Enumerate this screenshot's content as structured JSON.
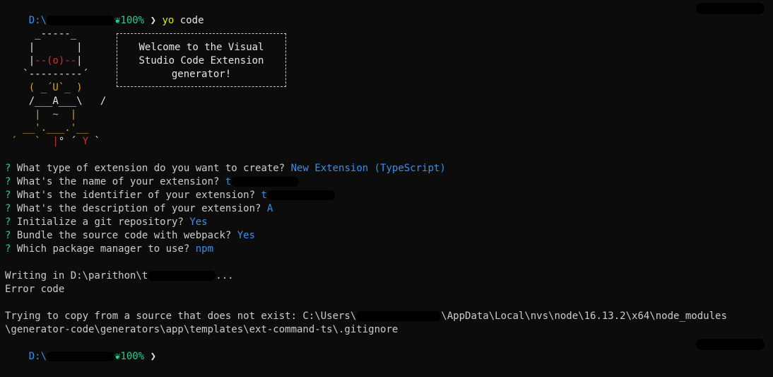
{
  "prompt": {
    "drive": "D:\\",
    "battery": "100%",
    "arrow": "❯",
    "command": "yo",
    "command_arg": "code"
  },
  "ascii_art": {
    "row1": "     _-----_",
    "row2": "    |       |",
    "row3a": "    |",
    "row3b": "--(o)--",
    "row3c": "|",
    "row4": "   `---------´",
    "row5": "    ( _´U`_ )",
    "row6": "    /___A___\\   /",
    "row7": "     |  ~  |",
    "row8": "   __'.___.'__",
    "row9a": " ´   `  ",
    "row9b": "|",
    "row9c": "° ´ ",
    "row9d": "Y",
    "row9e": " `"
  },
  "welcome": {
    "text": "Welcome to the Visual\nStudio Code Extension\ngenerator!"
  },
  "questions": [
    {
      "mark": "?",
      "q": "What type of extension do you want to create?",
      "a": "New Extension (TypeScript)"
    },
    {
      "mark": "?",
      "q": "What's the name of your extension?",
      "a": "t"
    },
    {
      "mark": "?",
      "q": "What's the identifier of your extension?",
      "a": "t"
    },
    {
      "mark": "?",
      "q": "What's the description of your extension?",
      "a": "A"
    },
    {
      "mark": "?",
      "q": "Initialize a git repository?",
      "a": "Yes"
    },
    {
      "mark": "?",
      "q": "Bundle the source code with webpack?",
      "a": "Yes"
    },
    {
      "mark": "?",
      "q": "Which package manager to use?",
      "a": "npm"
    }
  ],
  "output": {
    "writing_prefix": "Writing in D:\\parithon\\t",
    "writing_suffix": "...",
    "error": "Error code",
    "copy_prefix": "Trying to copy from a source that does not exist: C:\\Users\\",
    "copy_suffix": "\\AppData\\Local\\nvs\\node\\16.13.2\\x64\\node_modules",
    "copy_line2": "\\generator-code\\generators\\app\\templates\\ext-command-ts\\.gitignore"
  },
  "colors": {
    "background": "#0c0c0c",
    "answer": "#3b8eea",
    "question_mark": "#23d18b",
    "command": "#e5e510"
  },
  "icons": {
    "battery": "leaf-icon"
  }
}
